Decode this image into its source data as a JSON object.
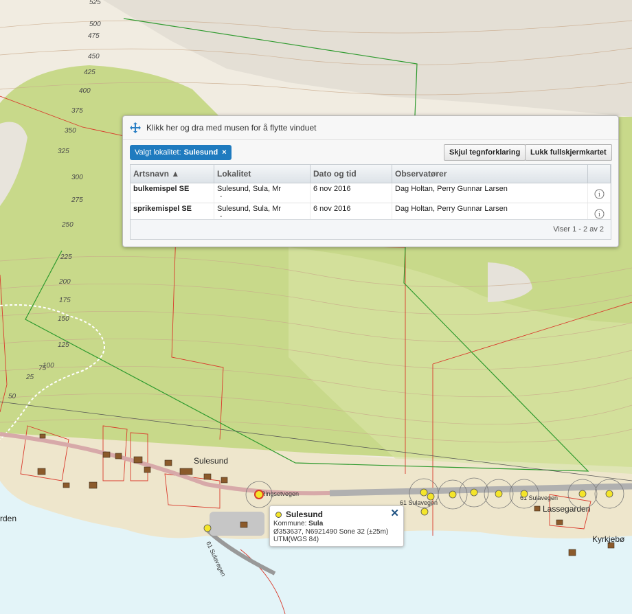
{
  "map": {
    "contour_labels": [
      "525",
      "500",
      "475",
      "450",
      "425",
      "400",
      "375",
      "350",
      "325",
      "300",
      "275",
      "250",
      "225",
      "200",
      "175",
      "150",
      "125",
      "100",
      "75",
      "50",
      "25"
    ],
    "place_labels": {
      "sulesund": "Sulesund",
      "lassegarden": "Lassegarden",
      "kyrkjebo": "Kyrkjebø",
      "garden_left": "rden"
    },
    "road_labels": {
      "ringsetvegen": "Ringsetvegen",
      "sulavegen_1": "61 Sulavegen",
      "sulavegen_2": "61 Sulavegen",
      "sulavegen_3": "61 Sulavegen"
    },
    "colors": {
      "forest": "#c8d98a",
      "terrain": "#f1ece1",
      "polygon": "#2e9a2e",
      "property": "#d9392b",
      "sea": "#e3f4f8",
      "marker": "#f4e52a"
    }
  },
  "panel": {
    "header_text": "Klikk her og dra med musen for å flytte vinduet",
    "filter": {
      "label": "Valgt lokalitet:",
      "value": "Sulesund",
      "close": "×"
    },
    "buttons": {
      "hide_legend": "Skjul tegnforklaring",
      "close_fullscreen": "Lukk fullskjermkartet"
    },
    "columns": [
      "Artsnavn ▲",
      "Lokalitet",
      "Dato og tid",
      "Observatører",
      ""
    ],
    "rows": [
      {
        "species": "bulkemispel  SE",
        "locality": "Sulesund, Sula, Mr",
        "locality_sub": "-",
        "date": "6 nov 2016",
        "observers": "Dag Holtan, Perry Gunnar Larsen",
        "info": "i"
      },
      {
        "species": "sprikemispel  SE",
        "locality": "Sulesund, Sula, Mr",
        "locality_sub": "-",
        "date": "6 nov 2016",
        "observers": "Dag Holtan, Perry Gunnar Larsen",
        "info": "i"
      }
    ],
    "footer": "Viser 1 - 2 av 2"
  },
  "popup": {
    "title": "Sulesund",
    "close": "✕",
    "kommune_label": "Kommune:",
    "kommune_value": "Sula",
    "coords": "Ø353637, N6921490 Sone 32 (±25m)",
    "datum": "UTM(WGS 84)"
  }
}
